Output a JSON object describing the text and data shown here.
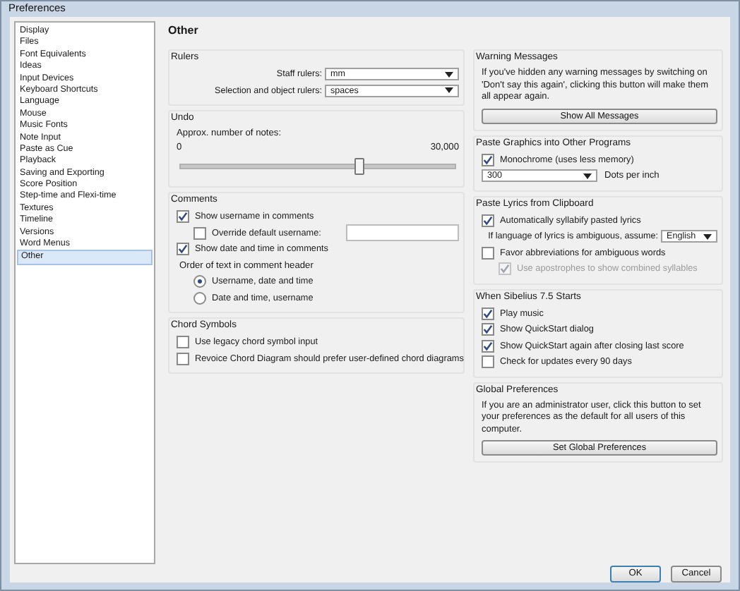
{
  "window": {
    "title": "Preferences"
  },
  "sidebar": {
    "items": [
      {
        "label": "Display",
        "selected": false
      },
      {
        "label": "Files",
        "selected": false
      },
      {
        "label": "Font Equivalents",
        "selected": false
      },
      {
        "label": "Ideas",
        "selected": false
      },
      {
        "label": "Input Devices",
        "selected": false
      },
      {
        "label": "Keyboard Shortcuts",
        "selected": false
      },
      {
        "label": "Language",
        "selected": false
      },
      {
        "label": "Mouse",
        "selected": false
      },
      {
        "label": "Music Fonts",
        "selected": false
      },
      {
        "label": "Note Input",
        "selected": false
      },
      {
        "label": "Paste as Cue",
        "selected": false
      },
      {
        "label": "Playback",
        "selected": false
      },
      {
        "label": "Saving and Exporting",
        "selected": false
      },
      {
        "label": "Score Position",
        "selected": false
      },
      {
        "label": "Step-time and Flexi-time",
        "selected": false
      },
      {
        "label": "Textures",
        "selected": false
      },
      {
        "label": "Timeline",
        "selected": false
      },
      {
        "label": "Versions",
        "selected": false
      },
      {
        "label": "Word Menus",
        "selected": false
      },
      {
        "label": "Other",
        "selected": true
      }
    ]
  },
  "page_title": "Other",
  "columns": [
    [
      {
        "title": "Rulers",
        "rows": [
          {
            "kind": "dropdown",
            "label": "Staff rulers:",
            "value": "mm"
          },
          {
            "kind": "dropdown",
            "label": "Selection and object rulers:",
            "value": "spaces"
          }
        ]
      },
      {
        "title": "Undo",
        "rows": [
          {
            "kind": "slider",
            "label": "Approx. number of notes:",
            "min": "0",
            "max": "30,000",
            "level": 0.65
          }
        ]
      },
      {
        "title": "Comments",
        "rows": [
          {
            "kind": "checkbox",
            "label": "Show username in comments",
            "checked": true,
            "disabled": false,
            "indent": false
          },
          {
            "kind": "checkbox-field",
            "label": "Override default username:",
            "checked": false,
            "disabled": false,
            "indent": true
          },
          {
            "kind": "checkbox",
            "label": "Show date and time in comments",
            "checked": true,
            "disabled": false,
            "indent": false
          },
          {
            "kind": "text",
            "label": "Order of text in comment header"
          },
          {
            "kind": "radio",
            "label": "Username, date and time",
            "selected": true
          },
          {
            "kind": "radio",
            "label": "Date and time, username",
            "selected": false
          }
        ]
      },
      {
        "title": "Chord Symbols",
        "rows": [
          {
            "kind": "checkbox",
            "label": "Use legacy chord symbol input",
            "checked": false,
            "disabled": false,
            "indent": false
          },
          {
            "kind": "checkbox",
            "label": "Revoice Chord Diagram should prefer user-defined chord diagrams",
            "checked": false,
            "disabled": false,
            "indent": false
          }
        ]
      }
    ],
    [
      {
        "title": "Warning Messages",
        "rows": [
          {
            "kind": "note",
            "label": "If you've hidden any warning messages by switching on 'Don't say this again', clicking this button will make them all appear again."
          },
          {
            "kind": "button",
            "label": "Show All Messages"
          }
        ]
      },
      {
        "title": "Paste Graphics into Other Programs",
        "rows": [
          {
            "kind": "checkbox",
            "label": "Monochrome (uses less memory)",
            "checked": true,
            "disabled": false,
            "indent": false
          },
          {
            "kind": "dropdown-unit",
            "value": "300",
            "unit": "Dots per inch"
          }
        ]
      },
      {
        "title": "Paste Lyrics from Clipboard",
        "rows": [
          {
            "kind": "checkbox",
            "label": "Automatically syllabify pasted lyrics",
            "checked": true,
            "disabled": false,
            "indent": false
          },
          {
            "kind": "dropdown-short",
            "label": "If language of lyrics is ambiguous, assume:",
            "value": "English"
          },
          {
            "kind": "checkbox",
            "label": "Favor abbreviations for ambiguous words",
            "checked": false,
            "disabled": false,
            "indent": false
          },
          {
            "kind": "checkbox",
            "label": "Use apostrophes to show combined syllables",
            "checked": true,
            "disabled": true,
            "indent": true
          }
        ]
      },
      {
        "title": "When Sibelius 7.5 Starts",
        "rows": [
          {
            "kind": "checkbox",
            "label": "Play music",
            "checked": true,
            "disabled": false,
            "indent": false
          },
          {
            "kind": "checkbox",
            "label": "Show QuickStart dialog",
            "checked": true,
            "disabled": false,
            "indent": false
          },
          {
            "kind": "checkbox",
            "label": "Show QuickStart again after closing last score",
            "checked": true,
            "disabled": false,
            "indent": false
          },
          {
            "kind": "checkbox",
            "label": "Check for updates every 90 days",
            "checked": false,
            "disabled": false,
            "indent": false
          }
        ]
      },
      {
        "title": "Global Preferences",
        "rows": [
          {
            "kind": "note",
            "label": "If you are an administrator user, click this button to set your preferences as the default for all users of this computer."
          },
          {
            "kind": "button",
            "label": "Set Global Preferences"
          }
        ]
      }
    ]
  ],
  "buttons": [
    "OK",
    "Cancel"
  ]
}
